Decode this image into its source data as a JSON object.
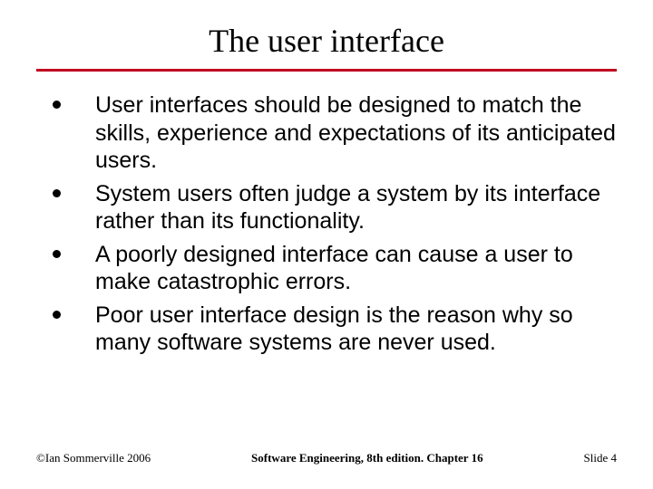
{
  "title": "The user interface",
  "bullets": [
    "User interfaces should be designed to match the skills, experience and expectations of its anticipated users.",
    "System users often judge a system by its interface rather than its functionality.",
    "A poorly designed interface can cause a user to make catastrophic errors.",
    "Poor user interface design is the reason why so many software systems are never used."
  ],
  "footer": {
    "left": "©Ian Sommerville 2006",
    "center": "Software Engineering, 8th edition. Chapter 16",
    "right": "Slide 4"
  }
}
